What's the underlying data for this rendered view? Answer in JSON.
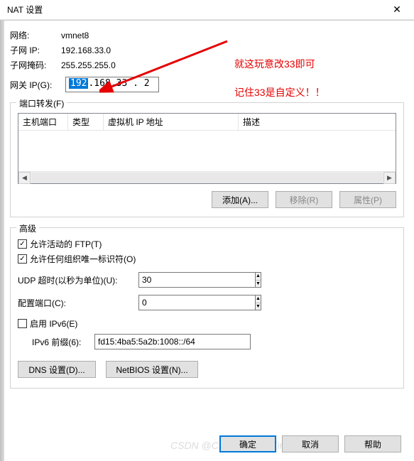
{
  "title": "NAT 设置",
  "network": {
    "label": "网络:",
    "value": "vmnet8"
  },
  "subnet_ip": {
    "label": "子网 IP:",
    "value": "192.168.33.0"
  },
  "subnet_mask": {
    "label": "子网掩码:",
    "value": "255.255.255.0"
  },
  "gateway": {
    "label": "网关 IP(G):",
    "sel": "192",
    "rest": ".168.33 . 2"
  },
  "port_forward": {
    "legend": "端口转发(F)",
    "cols": {
      "host_port": "主机端口",
      "type": "类型",
      "vm_ip": "虚拟机 IP 地址",
      "desc": "描述"
    },
    "buttons": {
      "add": "添加(A)...",
      "remove": "移除(R)",
      "props": "属性(P)"
    }
  },
  "advanced": {
    "legend": "高级",
    "allow_ftp": "允许活动的 FTP(T)",
    "allow_oui": "允许任何组织唯一标识符(O)",
    "udp_label": "UDP 超时(以秒为单位)(U):",
    "udp_value": "30",
    "cfg_port_label": "配置端口(C):",
    "cfg_port_value": "0",
    "enable_ipv6": "启用 IPv6(E)",
    "ipv6_prefix_label": "IPv6 前缀(6):",
    "ipv6_prefix_value": "fd15:4ba5:5a2b:1008::/64",
    "dns_btn": "DNS 设置(D)...",
    "netbios_btn": "NetBIOS 设置(N)..."
  },
  "footer": {
    "ok": "确定",
    "cancel": "取消",
    "help": "帮助"
  },
  "annot": {
    "line1": "就这玩意改33即可",
    "line2": "记住33是自定义！！"
  },
  "watermark": "CSDN @Chen_Liang_Xin",
  "checked_glyph": "✓"
}
